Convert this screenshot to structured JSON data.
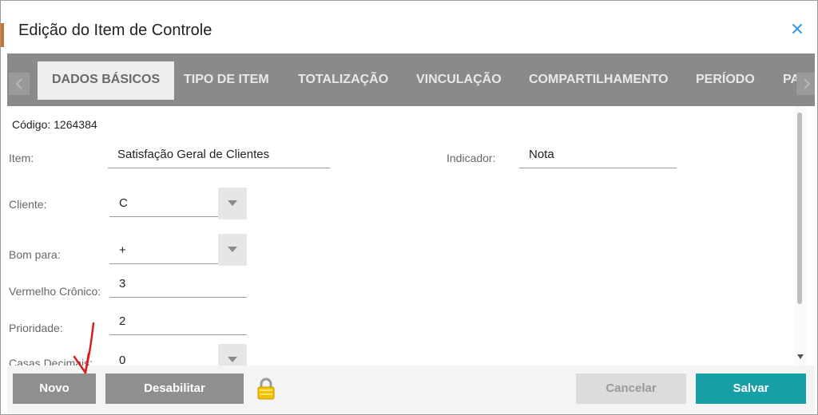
{
  "dialog": {
    "title": "Edição do Item de Controle"
  },
  "tabs": [
    {
      "label": "DADOS BÁSICOS",
      "active": true
    },
    {
      "label": "TIPO DE ITEM",
      "active": false
    },
    {
      "label": "TOTALIZAÇÃO",
      "active": false
    },
    {
      "label": "VINCULAÇÃO",
      "active": false
    },
    {
      "label": "COMPARTILHAMENTO",
      "active": false
    },
    {
      "label": "PERÍODO",
      "active": false
    },
    {
      "label": "PA",
      "active": false
    }
  ],
  "form": {
    "code": "Código: 1264384",
    "item_label": "Item:",
    "item_value": "Satisfação Geral de Clientes",
    "indicator_label": "Indicador:",
    "indicator_value": "Nota",
    "client_label": "Cliente:",
    "client_value": "C",
    "good_for_label": "Bom para:",
    "good_for_value": "+",
    "chronic_red_label": "Vermelho Crônico:",
    "chronic_red_value": "3",
    "priority_label": "Prioridade:",
    "priority_value": "2",
    "decimals_label": "Casas Decimais:",
    "decimals_value": "0"
  },
  "footer": {
    "new_label": "Novo",
    "disable_label": "Desabilitar",
    "cancel_label": "Cancelar",
    "save_label": "Salvar"
  },
  "icons": {
    "close": "close-icon",
    "lock": "lock-icon",
    "tab_left": "chevron-left-icon",
    "tab_right": "chevron-right-icon",
    "dropdown": "caret-down-icon"
  },
  "colors": {
    "accent": "#16a0a6",
    "tab_bar": "#8a8a8a",
    "button_gray": "#8f8f8f",
    "annotation": "#d81e1e"
  }
}
